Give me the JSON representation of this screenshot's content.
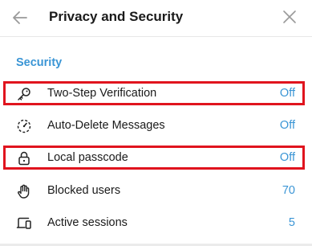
{
  "header": {
    "title": "Privacy and Security",
    "back_icon": "arrow-left-icon",
    "close_icon": "close-icon"
  },
  "section": {
    "title": "Security"
  },
  "rows": [
    {
      "label": "Two-Step Verification",
      "value": "Off",
      "icon": "key-icon"
    },
    {
      "label": "Auto-Delete Messages",
      "value": "Off",
      "icon": "timer-icon"
    },
    {
      "label": "Local passcode",
      "value": "Off",
      "icon": "lock-icon"
    },
    {
      "label": "Blocked users",
      "value": "70",
      "icon": "hand-icon"
    },
    {
      "label": "Active sessions",
      "value": "5",
      "icon": "devices-icon"
    }
  ],
  "colors": {
    "accent": "#3a95d5",
    "highlight": "#e0141e"
  }
}
